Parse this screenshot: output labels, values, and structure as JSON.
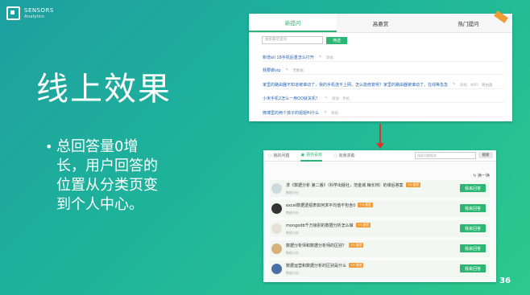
{
  "brand": {
    "line1": "SENSORS",
    "line2": "Analytics"
  },
  "slide": {
    "title": "线上效果",
    "bullet_lines": [
      "总回答量0增",
      "长，用户回答的",
      "位置从分类页变",
      "到个人中心。"
    ],
    "page_number": "36"
  },
  "top_panel": {
    "tabs": [
      "新提问",
      "高悬赏",
      "热门提问"
    ],
    "search_placeholder": "搜索最近提问",
    "filter_label": "筛选",
    "questions": [
      {
        "title": "新增all 18手机后重怎么打开",
        "meta": "添加"
      },
      {
        "title": "我要做vip",
        "meta": "无数据"
      },
      {
        "title": "家里的路由器不知道被谁动了，我的手机连不上网，怎么能修复呢？家里的路由器被谁动了，在线等急急急",
        "meta": "添加 · WIFI · 路由器"
      },
      {
        "title": "小米手机2怎么一用QQ就关机？",
        "meta": "添加 · 手机"
      },
      {
        "title": "微博里的两个孩子的姐姐叫什么",
        "meta": "添加"
      }
    ]
  },
  "bottom_panel": {
    "tabs": [
      "我的问题",
      "猜你喜欢",
      "向我求助"
    ],
    "search_placeholder": "搜索问题相关",
    "search_button": "搜索",
    "refresh_label": "换一换",
    "answer_label": "我来回答",
    "rows": [
      {
        "question": "求《数据分析 第二版》（科学出版社，范金城 梅长林）的课后答案",
        "badge": "+5 悬赏",
        "meta": "数据分析",
        "avatar_color": "#cfd8dc"
      },
      {
        "question": "excel数据透视表如何求平均值不包含0",
        "badge": "+5 悬赏",
        "meta": "数据分析",
        "avatar_color": "#333333"
      },
      {
        "question": "mongodb千万级别的数据分析怎么做",
        "badge": "+5 悬赏",
        "meta": "数据分析",
        "avatar_color": "#e7e1d5"
      },
      {
        "question": "数据分析师和数据分析师的区别？",
        "badge": "+5 悬赏",
        "meta": "数据分析",
        "avatar_color": "#d4b27a"
      },
      {
        "question": "数据运营和数据分析的区别是什么",
        "badge": "+5 悬赏",
        "meta": "数据分析",
        "avatar_color": "#4a6fa5"
      }
    ]
  },
  "colors": {
    "accent": "#2bb673",
    "badge": "#f29c38",
    "arrow": "#d9342b"
  }
}
